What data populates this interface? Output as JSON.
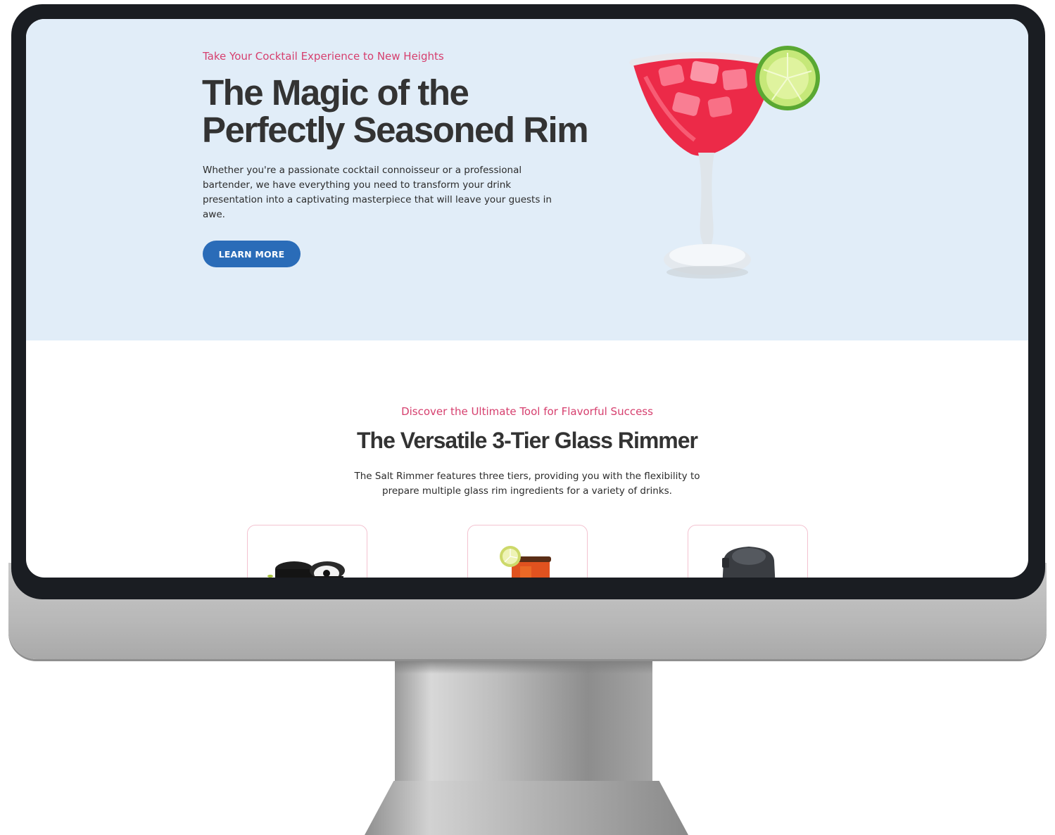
{
  "hero": {
    "eyebrow": "Take Your Cocktail Experience to New Heights",
    "title": "The Magic of the Perfectly Seasoned Rim",
    "body": "Whether you're a passionate cocktail connoisseur or a professional bartender, we have everything you need to transform your drink presentation into a captivating masterpiece that will leave your guests in awe.",
    "button_label": "LEARN MORE",
    "image": "margarita-glass-with-lime-icon"
  },
  "feature": {
    "eyebrow": "Discover the Ultimate Tool for Flavorful Success",
    "title": "The Versatile 3-Tier Glass Rimmer",
    "body": "The Salt Rimmer features three tiers, providing you with the flexibility to prepare multiple glass rim ingredients for a variety of drinks.",
    "cards": [
      {
        "image": "rimmer-tiers-icon"
      },
      {
        "image": "rimmed-cocktail-icon"
      },
      {
        "image": "closed-rimmer-icon"
      }
    ]
  },
  "colors": {
    "accent_pink": "#d63f6e",
    "button_blue": "#2a6cb8",
    "hero_bg": "#e1edf8",
    "heading": "#333333"
  }
}
